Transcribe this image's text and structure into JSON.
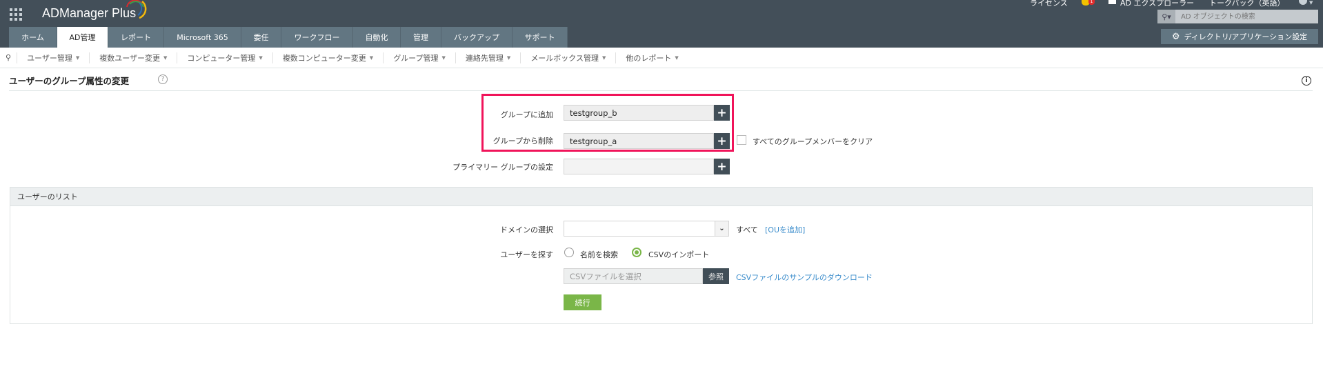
{
  "header": {
    "app_name": "ADManager Plus",
    "license": "ライセンス",
    "notification_count": "1",
    "ad_explorer": "AD エクスプローラー",
    "talkback": "トークバック（英語）",
    "search_placeholder": "AD オブジェクトの検索",
    "settings_button": "ディレクトリ/アプリケーション設定"
  },
  "tabs": [
    "ホーム",
    "AD管理",
    "レポート",
    "Microsoft 365",
    "委任",
    "ワークフロー",
    "自動化",
    "管理",
    "バックアップ",
    "サポート"
  ],
  "submenu": [
    "ユーザー管理",
    "複数ユーザー変更",
    "コンピューター管理",
    "複数コンピューター変更",
    "グループ管理",
    "連絡先管理",
    "メールボックス管理",
    "他のレポート"
  ],
  "page": {
    "title": "ユーザーのグループ属性の変更",
    "help": "?",
    "info": "i"
  },
  "form": {
    "add_label": "グループに追加",
    "add_value": "testgroup_b",
    "remove_label": "グループから削除",
    "remove_value": "testgroup_a",
    "clear_label": "すべてのグループメンバーをクリア",
    "primary_label": "プライマリー グループの設定",
    "primary_value": "",
    "plus": "+"
  },
  "user_list": {
    "title": "ユーザーのリスト",
    "domain_label": "ドメインの選択",
    "domain_value": "",
    "all": "すべて",
    "add_ou": "[OUを追加]",
    "find_label": "ユーザーを探す",
    "radio_name": "名前を検索",
    "radio_csv": "CSVのインポート",
    "csv_placeholder": "CSVファイルを選択",
    "browse": "参照",
    "sample_link": "CSVファイルのサンプルのダウンロード",
    "continue": "続行"
  },
  "colors": {
    "header": "#434f59",
    "tab": "#627682",
    "accent_green": "#7ab648",
    "highlight": "#f0145a",
    "link": "#3a8ccb"
  }
}
